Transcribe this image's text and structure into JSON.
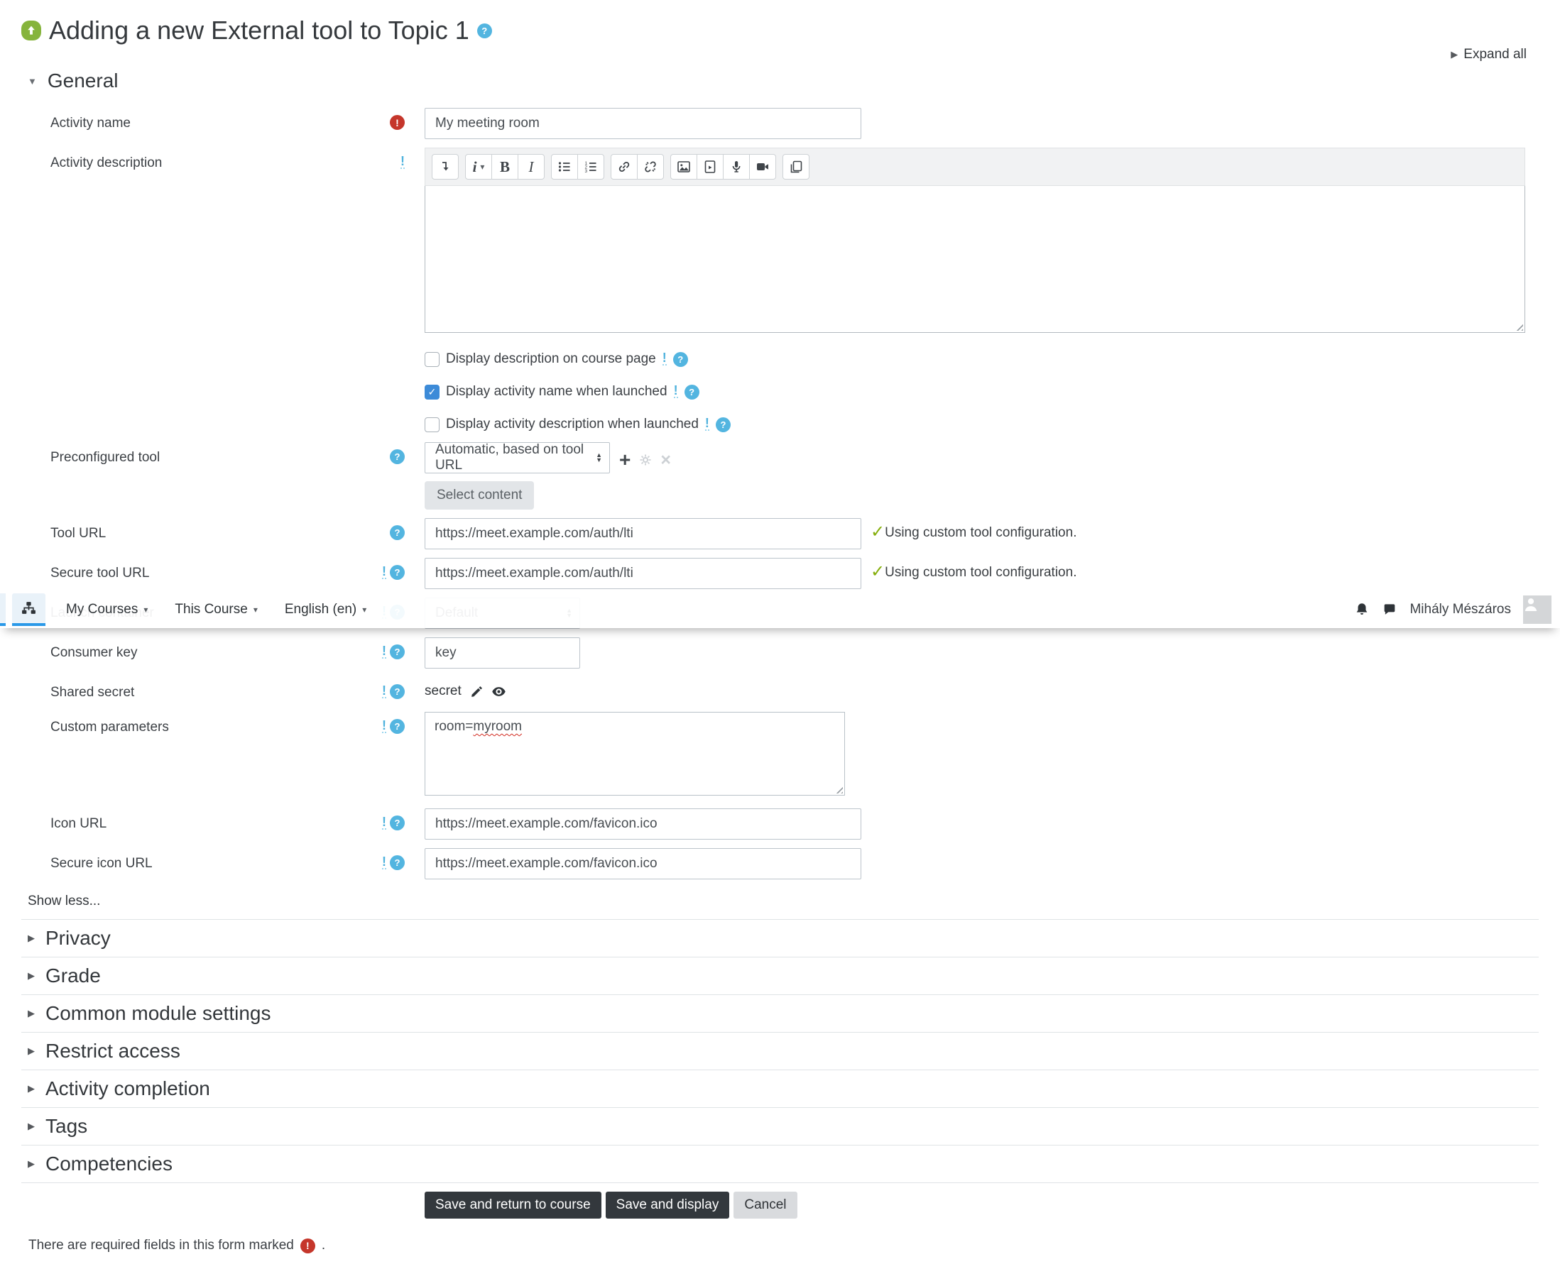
{
  "header": {
    "title": "Adding a new External tool to Topic 1",
    "expand_all": "Expand all"
  },
  "navbar": {
    "menus": [
      {
        "label": "My Courses"
      },
      {
        "label": "This Course"
      },
      {
        "label": "English (en)"
      }
    ],
    "user_name": "Mihály Mészáros",
    "icons": [
      "sitemap-icon",
      "bell-icon",
      "chat-icon",
      "avatar"
    ]
  },
  "form": {
    "general_heading": "General",
    "activity_name": {
      "label": "Activity name",
      "value": "My meeting room"
    },
    "activity_description": {
      "label": "Activity description",
      "value": ""
    },
    "display_description": {
      "label": "Display description on course page",
      "checked": false
    },
    "display_activity_name": {
      "label": "Display activity name when launched",
      "checked": true
    },
    "display_activity_description": {
      "label": "Display activity description when launched",
      "checked": false
    },
    "preconfigured_tool": {
      "label": "Preconfigured tool",
      "selected": "Automatic, based on tool URL",
      "select_content_button": "Select content"
    },
    "tool_url": {
      "label": "Tool URL",
      "value": "https://meet.example.com/auth/lti",
      "status": "Using custom tool configuration."
    },
    "secure_tool_url": {
      "label": "Secure tool URL",
      "value": "https://meet.example.com/auth/lti",
      "status": "Using custom tool configuration."
    },
    "launch_container": {
      "label": "Launch container",
      "selected": "Default"
    },
    "consumer_key": {
      "label": "Consumer key",
      "value": "key"
    },
    "shared_secret": {
      "label": "Shared secret",
      "value": "secret"
    },
    "custom_parameters": {
      "label": "Custom parameters",
      "value_before": "room=",
      "misspelled_word": "myroom"
    },
    "icon_url": {
      "label": "Icon URL",
      "value": "https://meet.example.com/favicon.ico"
    },
    "secure_icon_url": {
      "label": "Secure icon URL",
      "value": "https://meet.example.com/favicon.ico"
    },
    "show_less": "Show less...",
    "collapsed_sections": [
      "Privacy",
      "Grade",
      "Common module settings",
      "Restrict access",
      "Activity completion",
      "Tags",
      "Competencies"
    ],
    "buttons": {
      "save_return": "Save and return to course",
      "save_display": "Save and display",
      "cancel": "Cancel"
    },
    "required_note": {
      "text": "There are required fields in this form marked",
      "suffix": "."
    }
  },
  "editor": {
    "toolbar_icons": [
      "collapse-toolbar-icon",
      "paragraph-format-icon",
      "bold-icon",
      "italic-icon",
      "unordered-list-icon",
      "ordered-list-icon",
      "link-icon",
      "unlink-icon",
      "insert-image-icon",
      "insert-media-icon",
      "record-audio-icon",
      "record-video-icon",
      "manage-files-icon"
    ]
  },
  "colors": {
    "help_icon_blue": "#53b5e0",
    "required_red": "#c5362b",
    "checkbox_blue": "#3d8bd8",
    "check_green": "#85ae0b",
    "navbar_tab_blue": "#2a99e8",
    "tool_icon_green": "#86b43c",
    "button_dark": "#33383d"
  }
}
